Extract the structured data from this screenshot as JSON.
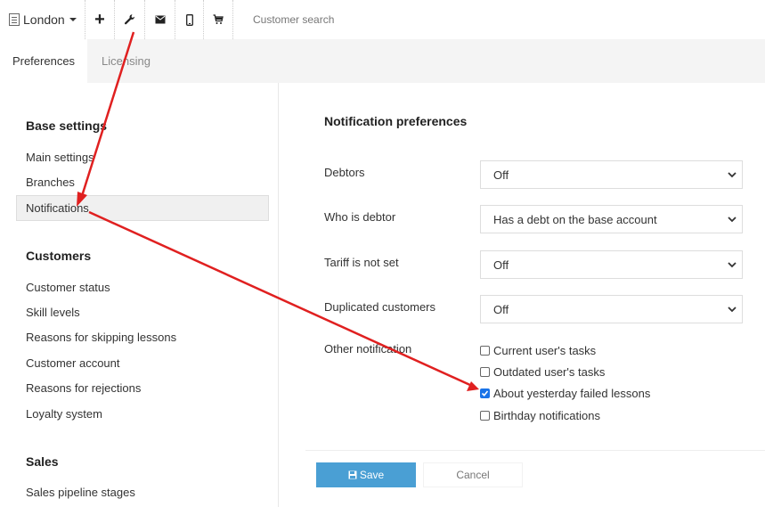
{
  "toolbar": {
    "branch": "London",
    "plus": "+",
    "search_placeholder": "Customer search",
    "icons": [
      "branch-icon",
      "plus-icon",
      "wrench-icon",
      "mail-icon",
      "phone-icon",
      "cart-icon"
    ]
  },
  "tabs": [
    {
      "label": "Preferences",
      "active": true
    },
    {
      "label": "Licensing",
      "active": false
    }
  ],
  "sidebar": {
    "sections": [
      {
        "title": "Base settings",
        "items": [
          "Main settings",
          "Branches",
          "Notifications"
        ]
      },
      {
        "title": "Customers",
        "items": [
          "Customer status",
          "Skill levels",
          "Reasons for skipping lessons",
          "Customer account",
          "Reasons for rejections",
          "Loyalty system"
        ]
      },
      {
        "title": "Sales",
        "items": [
          "Sales pipeline stages"
        ]
      }
    ],
    "active_item": "Notifications"
  },
  "main": {
    "title": "Notification preferences",
    "fields": [
      {
        "label": "Debtors",
        "value": "Off"
      },
      {
        "label": "Who is debtor",
        "value": "Has a debt on the base account"
      },
      {
        "label": "Tariff is not set",
        "value": "Off"
      },
      {
        "label": "Duplicated customers",
        "value": "Off"
      }
    ],
    "other_label": "Other notification",
    "checkboxes": [
      {
        "label": "Current user's tasks",
        "checked": false
      },
      {
        "label": "Outdated user's tasks",
        "checked": false
      },
      {
        "label": "About yesterday failed lessons",
        "checked": true
      },
      {
        "label": "Birthday notifications",
        "checked": false
      }
    ],
    "save_label": "Save",
    "cancel_label": "Cancel"
  },
  "colors": {
    "accent": "#4a9fd4",
    "checkbox": "#1a73e8",
    "annotation_arrow": "#e02020"
  }
}
